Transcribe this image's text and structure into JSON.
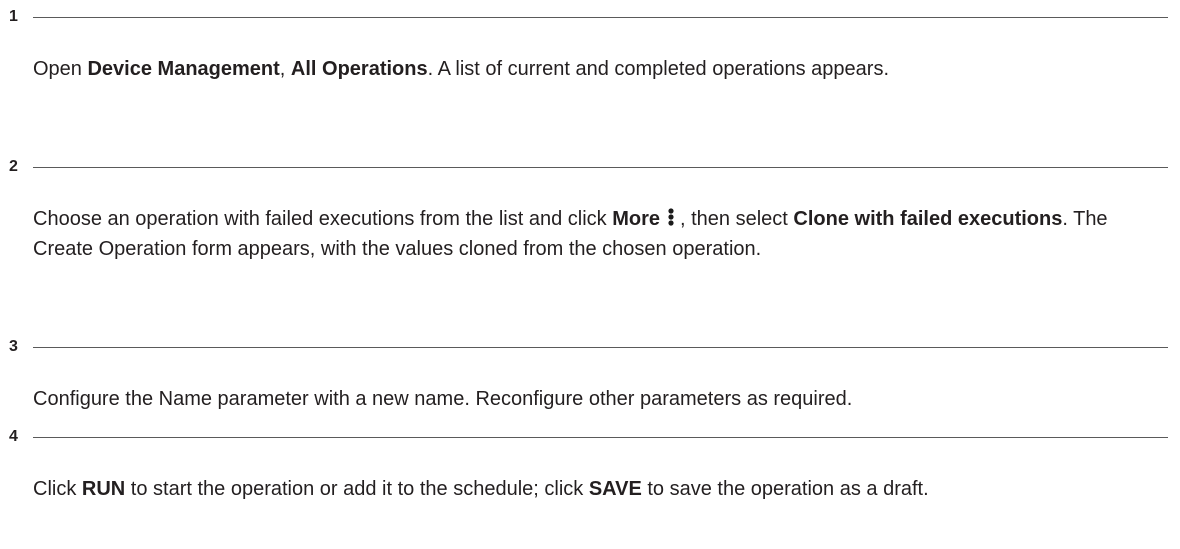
{
  "steps": [
    {
      "number": "1",
      "parts": [
        {
          "text": "Open ",
          "bold": false
        },
        {
          "text": "Device Management",
          "bold": true
        },
        {
          "text": ", ",
          "bold": false
        },
        {
          "text": "All Operations",
          "bold": true
        },
        {
          "text": ". A list of current and completed operations appears.",
          "bold": false
        }
      ]
    },
    {
      "number": "2",
      "parts": [
        {
          "text": "Choose an operation with failed executions from the list and click ",
          "bold": false
        },
        {
          "text": "More",
          "bold": true
        },
        {
          "icon": "more-vertical-icon"
        },
        {
          "text": ", then select ",
          "bold": false
        },
        {
          "text": "Clone with failed executions",
          "bold": true
        },
        {
          "text": ". The Create Operation form appears, with the values cloned from the chosen operation.",
          "bold": false
        }
      ]
    },
    {
      "number": "3",
      "parts": [
        {
          "text": "Configure the Name parameter with a new name. Reconfigure other parameters as required.",
          "bold": false
        }
      ]
    },
    {
      "number": "4",
      "parts": [
        {
          "text": "Click ",
          "bold": false
        },
        {
          "text": "RUN",
          "bold": true
        },
        {
          "text": " to start the operation or add it to the schedule; click ",
          "bold": false
        },
        {
          "text": "SAVE",
          "bold": true
        },
        {
          "text": " to save the operation as a draft.",
          "bold": false
        }
      ]
    }
  ]
}
